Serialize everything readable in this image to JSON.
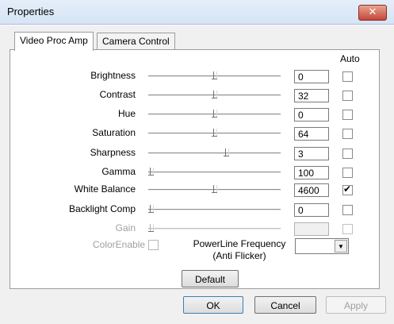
{
  "window": {
    "title": "Properties",
    "close_label": "✕"
  },
  "tabs": [
    {
      "label": "Video Proc Amp",
      "active": true
    },
    {
      "label": "Camera Control",
      "active": false
    }
  ],
  "auto_header": "Auto",
  "controls": [
    {
      "label": "Brightness",
      "value": "0",
      "level": 0.5,
      "auto": false,
      "enabled": true
    },
    {
      "label": "Contrast",
      "value": "32",
      "level": 0.5,
      "auto": false,
      "enabled": true
    },
    {
      "label": "Hue",
      "value": "0",
      "level": 0.5,
      "auto": false,
      "enabled": true
    },
    {
      "label": "Saturation",
      "value": "64",
      "level": 0.5,
      "auto": false,
      "enabled": true
    },
    {
      "label": "Sharpness",
      "value": "3",
      "level": 0.6,
      "auto": false,
      "enabled": true
    },
    {
      "label": "Gamma",
      "value": "100",
      "level": 0.0,
      "auto": false,
      "enabled": true
    },
    {
      "label": "White Balance",
      "value": "4600",
      "level": 0.5,
      "auto": true,
      "enabled": true
    },
    {
      "label": "Backlight Comp",
      "value": "0",
      "level": 0.0,
      "auto": false,
      "enabled": true
    },
    {
      "label": "Gain",
      "value": "",
      "level": 0.0,
      "auto": false,
      "enabled": false
    }
  ],
  "color_enable": {
    "label": "ColorEnable",
    "checked": false,
    "enabled": false
  },
  "powerline": {
    "label_line1": "PowerLine Frequency",
    "label_line2": "(Anti Flicker)",
    "value": ""
  },
  "buttons": {
    "default": "Default",
    "ok": "OK",
    "cancel": "Cancel",
    "apply": "Apply"
  }
}
